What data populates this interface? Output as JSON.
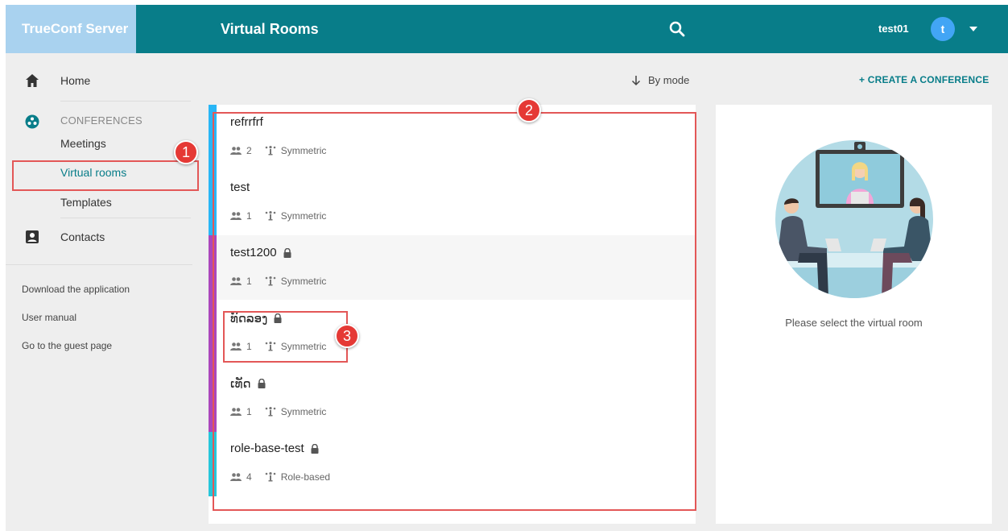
{
  "header": {
    "brand": "TrueConf Server",
    "title": "Virtual Rooms",
    "user_name": "test01",
    "avatar_letter": "t"
  },
  "sidebar": {
    "home": "Home",
    "section": "CONFERENCES",
    "meetings": "Meetings",
    "virtual_rooms": "Virtual rooms",
    "templates": "Templates",
    "contacts": "Contacts",
    "footer": [
      "Download the application",
      "User manual",
      "Go to the guest page"
    ]
  },
  "toolbar": {
    "sort_label": "By mode",
    "create_label": "+ CREATE A CONFERENCE"
  },
  "rooms": [
    {
      "name": "refrrfrf",
      "participants": "2",
      "mode": "Symmetric",
      "locked": false
    },
    {
      "name": "test",
      "participants": "1",
      "mode": "Symmetric",
      "locked": false
    },
    {
      "name": "test1200",
      "participants": "1",
      "mode": "Symmetric",
      "locked": true
    },
    {
      "name": "ທົດລອງ",
      "participants": "1",
      "mode": "Symmetric",
      "locked": true
    },
    {
      "name": "ເທັດ",
      "participants": "1",
      "mode": "Symmetric",
      "locked": true
    },
    {
      "name": "role-base-test",
      "participants": "4",
      "mode": "Role-based",
      "locked": true
    }
  ],
  "detail": {
    "empty_text": "Please select the virtual room"
  },
  "annotations": [
    "1",
    "2",
    "3"
  ],
  "colors": {
    "header": "#087d89",
    "brand_bg": "#a9d2ef",
    "accent": "#087d89",
    "annotation": "#e53935"
  }
}
